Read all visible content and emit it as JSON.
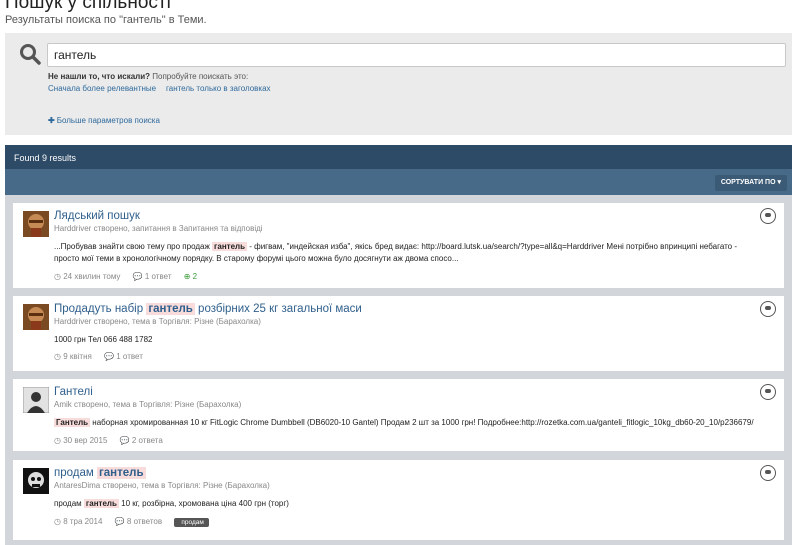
{
  "page": {
    "title": "Пошук у спільності",
    "subtitle": "Результаты поиска по \"гантель\" в Теми."
  },
  "search": {
    "value": "гантель",
    "hint_bold": "Не нашли то, что искали?",
    "hint_rest": " Попробуйте поискать это:",
    "suggest_relevant": "Сначала более релевантные",
    "suggest_titles": "гантель только в заголовках",
    "more_params": "Больше параметров поиска"
  },
  "results_header": {
    "found": "Found 9 results",
    "sort_label": "СОРТУВАТИ ПО ▾"
  },
  "results": [
    {
      "title_parts": [
        "Лядський пошук"
      ],
      "meta": "Harddriver створено, запитання в Запитання та відповіді",
      "body_pre": "...Пробував знайти свою тему про продаж ",
      "body_hl": "гантель",
      "body_post": " - фигвам, \"индейская изба\", якісь бред видає: http://board.lutsk.ua/search/?type=all&q=Harddriver Мені потрібно впринципі небагато - просто мої теми в хронологічному порядку. В старому форумі цього можна було досягнути аж двома спосо...",
      "time": "24 хвилин тому",
      "answers": "1 ответ",
      "votes": "2"
    },
    {
      "title_pre": "Продадуть набір ",
      "title_hl": "гантель",
      "title_post": " розбірних 25 кг загальної маси",
      "meta": "Harddriver створено, тема в Торгівля: Різне (Барахолка)",
      "body": "1000 грн Тел 066 488 1782",
      "time": "9 квітня",
      "answers": "1 ответ"
    },
    {
      "title": "Гантелі",
      "meta": "Amik створено, тема в Торгівля: Різне (Барахолка)",
      "body_hl": "Гантель",
      "body_post": " наборная хромированная 10 кг FitLogic Chrome Dumbbell (DB6020-10 Gantel) Продам 2 шт за 1000 грн! Подробнее:http://rozetka.com.ua/ganteli_fitlogic_10kg_db60-20_10/p236679/",
      "time": "30 вер 2015",
      "answers": "2 ответа"
    },
    {
      "title_pre": "продам ",
      "title_hl": "гантель",
      "meta": "AntaresDima створено, тема в Торгівля: Різне (Барахолка)",
      "body_pre": "продам ",
      "body_hl": "гантель",
      "body_post": " 10 кг, розбірна, хромована ціна 400 грн (торг)",
      "time": "8 тра 2014",
      "answers": "8 ответов",
      "tag": "продам"
    }
  ],
  "colors": {
    "header_bg": "#2d4a66",
    "sortbar_bg": "#486a89",
    "link": "#2f5f8c",
    "highlight": "#f8dcdc"
  }
}
